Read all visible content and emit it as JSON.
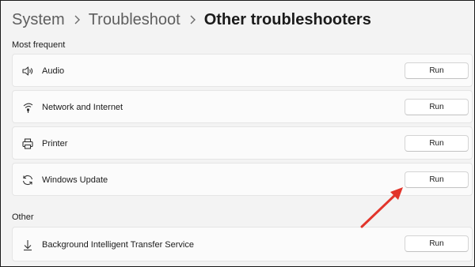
{
  "breadcrumb": {
    "items": [
      "System",
      "Troubleshoot",
      "Other troubleshooters"
    ]
  },
  "sections": {
    "most_frequent": "Most frequent",
    "other": "Other"
  },
  "troubleshooters": {
    "audio": {
      "label": "Audio",
      "action": "Run",
      "icon": "speaker-icon"
    },
    "network": {
      "label": "Network and Internet",
      "action": "Run",
      "icon": "network-icon"
    },
    "printer": {
      "label": "Printer",
      "action": "Run",
      "icon": "printer-icon"
    },
    "windows_update": {
      "label": "Windows Update",
      "action": "Run",
      "icon": "sync-icon"
    },
    "bits": {
      "label": "Background Intelligent Transfer Service",
      "action": "Run",
      "icon": "download-icon"
    }
  },
  "annotation": {
    "arrow_color": "#e2352b"
  }
}
